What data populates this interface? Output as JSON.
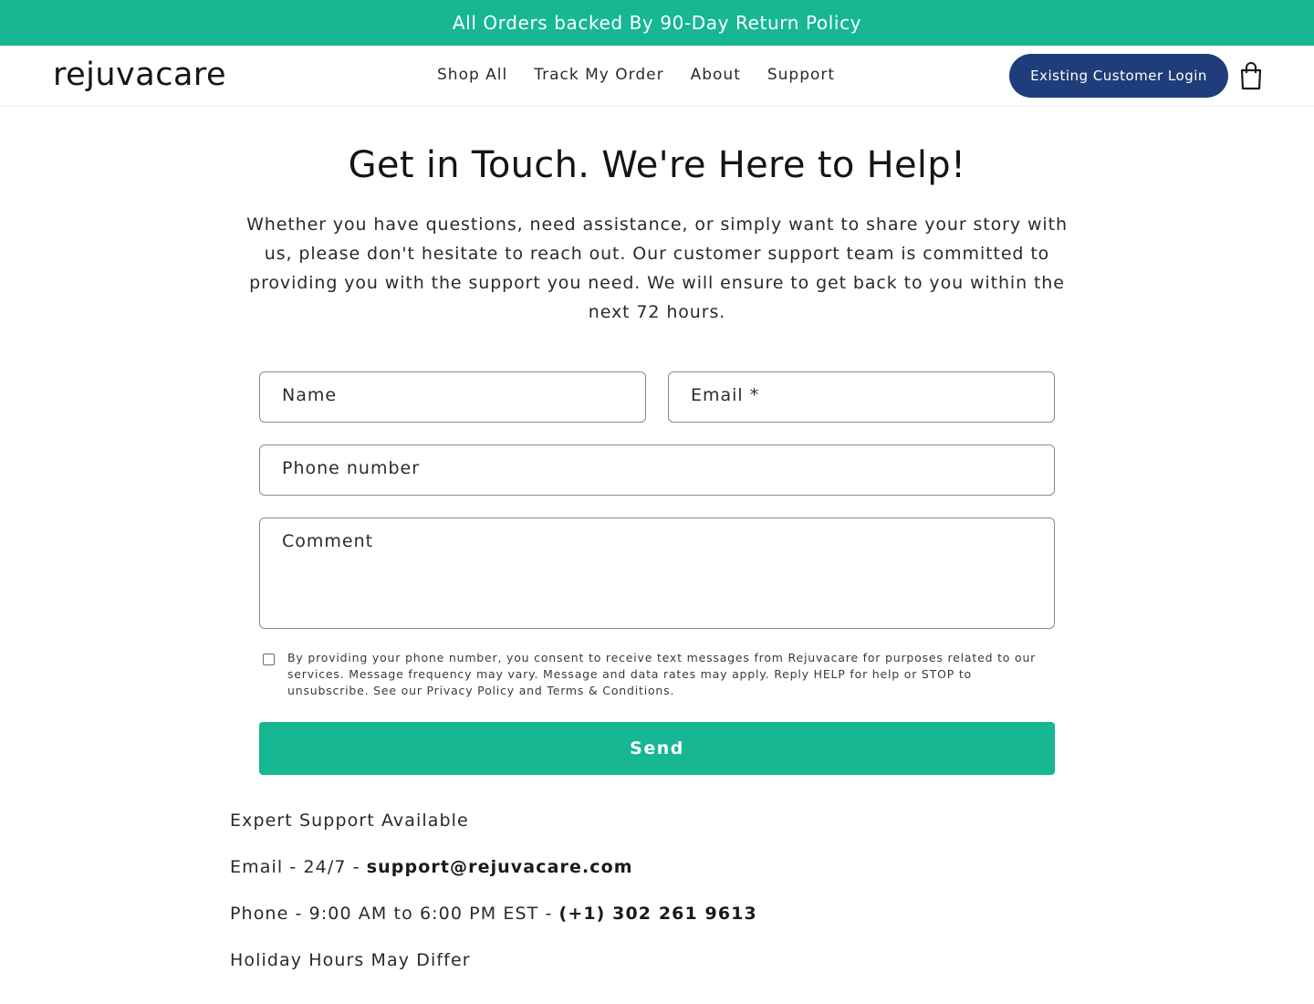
{
  "announcement": "All Orders backed By 90-Day Return Policy",
  "header": {
    "logo": "rejuvacare",
    "nav": [
      "Shop All",
      "Track My Order",
      "About",
      "Support"
    ],
    "login_label": "Existing Customer Login",
    "cart_icon": "shopping-bag-icon"
  },
  "main": {
    "title": "Get in Touch. We're Here to Help!",
    "intro": "Whether you have questions, need assistance, or simply want to share your story with us, please don't hesitate to reach out. Our customer support team is committed to providing you with the support you need. We will ensure to get back to you within the next 72 hours."
  },
  "form": {
    "name_placeholder": "Name",
    "email_placeholder": "Email *",
    "phone_placeholder": "Phone number",
    "comment_placeholder": "Comment",
    "consent_text": "By providing your phone number, you consent to receive text messages from Rejuvacare for purposes related to our services. Message frequency may vary. Message and data rates may apply. Reply HELP for help or STOP to unsubscribe. See our Privacy Policy and Terms & Conditions.",
    "send_label": "Send"
  },
  "support": {
    "heading": "Expert Support Available",
    "email_prefix": "Email - 24/7 - ",
    "email_value": "support@rejuvacare.com",
    "phone_prefix": "Phone - 9:00 AM to 6:00 PM EST - ",
    "phone_value": "(+1) 302 261 9613",
    "holiday": "Holiday Hours May Differ"
  },
  "colors": {
    "accent": "#16b792",
    "login_button": "#1f3d7a"
  }
}
